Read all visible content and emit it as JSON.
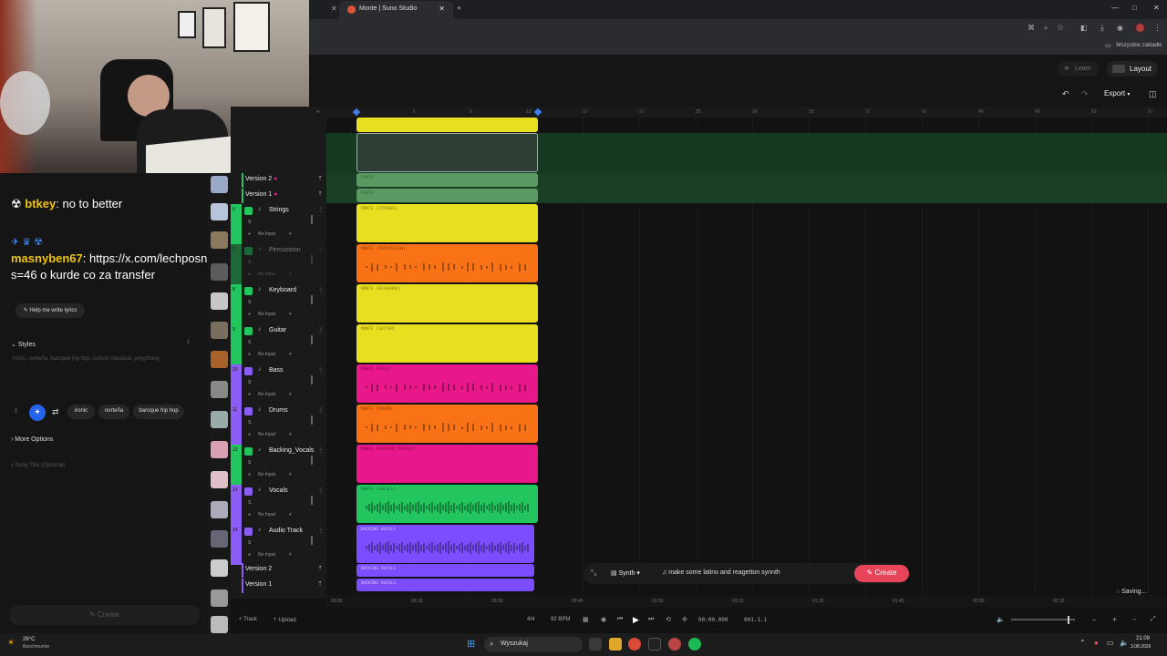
{
  "browser": {
    "active_tab_title": "Monte | Suno Studio",
    "bookmarks_label": "Wszystkie zakładki"
  },
  "app": {
    "learn_label": "Learn",
    "layout_label": "Layout",
    "export_label": "Export"
  },
  "chat": {
    "msg1_user": "btkey",
    "msg1_text": ": no to better",
    "msg2_user": "masnyben67",
    "msg2_text": ": https://x.com/lechposnanrus/status/20",
    "msg2_cont": "s=46 o kurde co za transfer"
  },
  "sidebar": {
    "help_lyrics": "Help me write lyrics",
    "styles_label": "Styles",
    "styles_placeholder": "ironic, norteña, baroque hip hop, turkish classical, polyphony",
    "tags": [
      "ironic",
      "norteña",
      "baroque hip hop"
    ],
    "more_options": "More Options",
    "song_title_placeholder": "Song Title (Optional)",
    "create_label": "Create"
  },
  "tracks": {
    "version2": "Version 2",
    "version1": "Version 1",
    "s_label": "S",
    "no_input": "No Input",
    "list": [
      {
        "num": "6",
        "name": "Strings",
        "color": "#22c55e"
      },
      {
        "num": "7",
        "name": "Percussion",
        "color": "#22c55e"
      },
      {
        "num": "8",
        "name": "Keyboard",
        "color": "#22c55e"
      },
      {
        "num": "9",
        "name": "Guitar",
        "color": "#22c55e"
      },
      {
        "num": "10",
        "name": "Bass",
        "color": "#8b5cf6"
      },
      {
        "num": "11",
        "name": "Drums",
        "color": "#8b5cf6"
      },
      {
        "num": "12",
        "name": "Backing_Vocals",
        "color": "#22c55e"
      },
      {
        "num": "13",
        "name": "Vocals",
        "color": "#8b5cf6"
      },
      {
        "num": "14",
        "name": "Audio Track",
        "color": "#8b5cf6"
      }
    ],
    "bottom_version2": "Version 2",
    "bottom_version1": "Version 1",
    "add_track": "+ Track",
    "upload": "Upload"
  },
  "ruler_marks": [
    "1",
    "5",
    "9",
    "13",
    "17",
    "21",
    "25",
    "29",
    "33",
    "37",
    "41",
    "45",
    "49",
    "53",
    "57"
  ],
  "clips": [
    {
      "label": "SYNTH",
      "color": "#86d68c"
    },
    {
      "label": "SYNTH",
      "color": "#86d68c"
    },
    {
      "label": "MONTE (STRINGS)",
      "color": "#e7df1f"
    },
    {
      "label": "MONTE (PERCUSSION)",
      "color": "#f97316"
    },
    {
      "label": "MONTE (KEYBOARD)",
      "color": "#e7df1f"
    },
    {
      "label": "MONTE (GUITAR)",
      "color": "#e7df1f"
    },
    {
      "label": "MONTE (BASS)",
      "color": "#e8178a"
    },
    {
      "label": "MONTE (DRUMS)",
      "color": "#f97316"
    },
    {
      "label": "MONTE (BACKING VOCALS)",
      "color": "#e8178a"
    },
    {
      "label": "MONTE (VOCALS)",
      "color": "#22c55e"
    },
    {
      "label": "BACKING VOCALS",
      "color": "#7c4dff"
    },
    {
      "label": "BACKING VOCALS",
      "color": "#7c4dff"
    },
    {
      "label": "BACKING VOCALS",
      "color": "#7c4dff"
    }
  ],
  "time_marks": [
    "00:00",
    "00:15",
    "00:30",
    "00:45",
    "01:00",
    "01:15",
    "01:30",
    "01:45",
    "02:00",
    "02:15"
  ],
  "transport": {
    "time_sig": "4/4",
    "bpm": "92 BPM",
    "time": "00:00.000",
    "position": "001.1.1"
  },
  "prompt": {
    "mode": "Synth",
    "text": "make some latino and reagetton synnth",
    "create": "Create",
    "saving": "Saving..."
  },
  "taskbar": {
    "temp": "26°C",
    "weather": "Bezchmurnie",
    "search": "Wyszukaj",
    "clock_time": "21:09",
    "clock_date": "3.08.2026"
  }
}
